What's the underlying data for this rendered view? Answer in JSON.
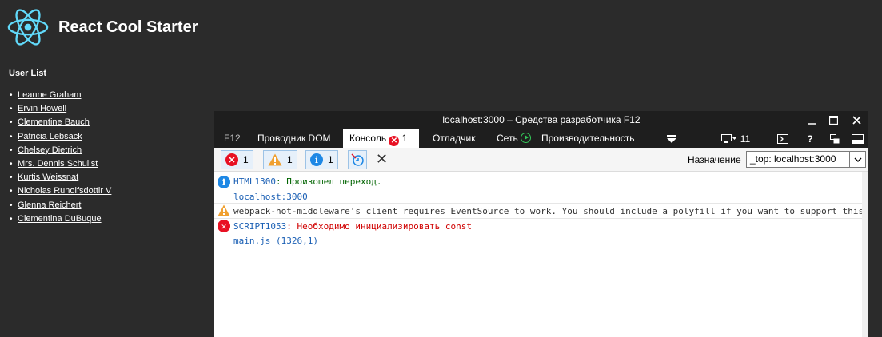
{
  "app": {
    "title": "React Cool Starter",
    "list_title": "User List",
    "users": [
      "Leanne Graham",
      "Ervin Howell",
      "Clementine Bauch",
      "Patricia Lebsack",
      "Chelsey Dietrich",
      "Mrs. Dennis Schulist",
      "Kurtis Weissnat",
      "Nicholas Runolfsdottir V",
      "Glenna Reichert",
      "Clementina DuBuque"
    ],
    "colors": {
      "background": "#2b2b2b",
      "logo": "#61dafb"
    }
  },
  "devtools": {
    "title": "localhost:3000 – Средства разработчика F12",
    "tabs": {
      "f12": "F12",
      "dom": "Проводник DOM",
      "console": "Консоль",
      "console_errors": "1",
      "debugger": "Отладчик",
      "network": "Сеть",
      "performance": "Производительность"
    },
    "emulation_count": "11",
    "toolbar": {
      "errors_count": "1",
      "warnings_count": "1",
      "info_count": "1",
      "target_label": "Назначение",
      "target_value": "_top: localhost:3000"
    },
    "messages": {
      "info_code": "HTML1300",
      "info_text": ": Произошел переход.",
      "info_source": "localhost:3000",
      "warn_text": "webpack-hot-middleware's client requires EventSource to work. You should include a polyfill if you want to support this",
      "err_code": "SCRIPT1053",
      "err_text": ": Необходимо инициализировать const",
      "err_source": "main.js (1326,1)"
    },
    "icons": {
      "minimize": "minimize-icon",
      "maximize": "maximize-icon",
      "close": "close-icon"
    }
  }
}
